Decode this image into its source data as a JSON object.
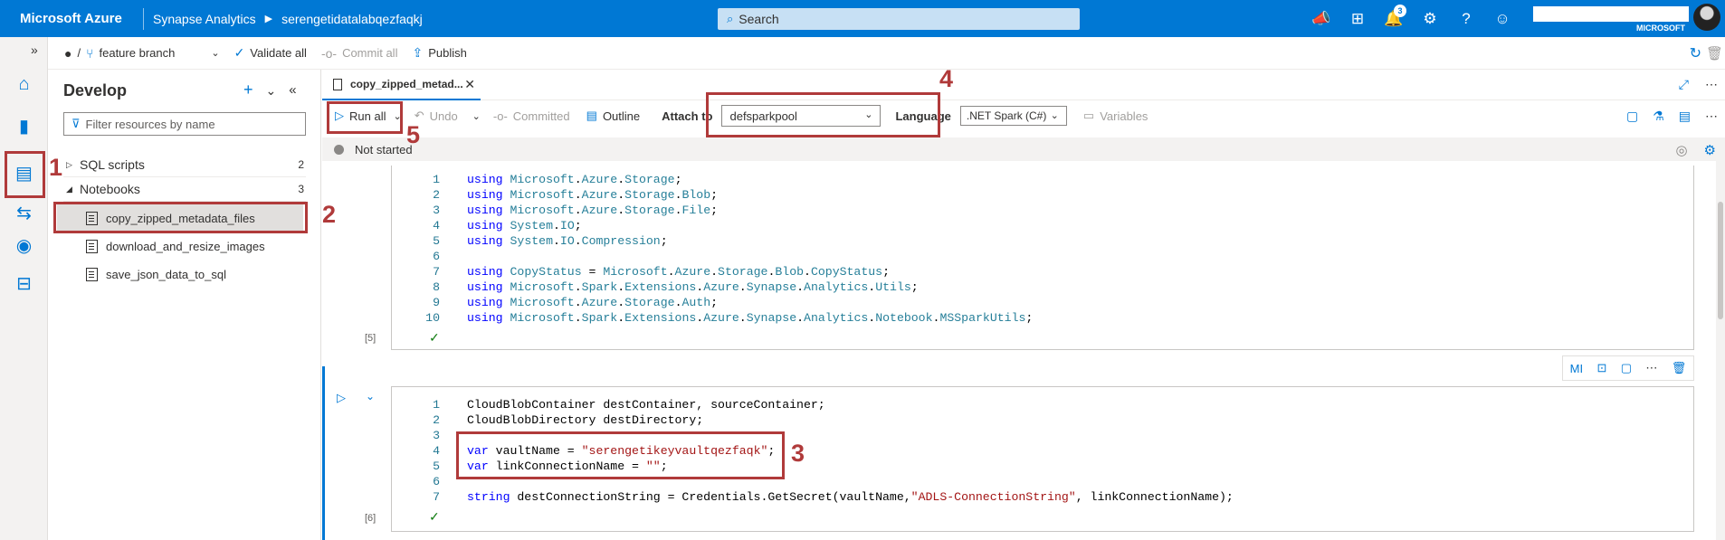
{
  "topbar": {
    "brand": "Microsoft Azure",
    "service": "Synapse Analytics",
    "workspace": "serengetidatalabqezfaqkj",
    "search_placeholder": "Search",
    "notifications_count": "3",
    "account_org": "MICROSOFT",
    "icons": [
      "announcement-icon",
      "portal-icon",
      "bell-icon",
      "gear-icon",
      "help-icon",
      "feedback-icon"
    ]
  },
  "git_toolbar": {
    "branch": "feature branch",
    "validate_all": "Validate all",
    "commit_all": "Commit all",
    "publish": "Publish",
    "separator": "/"
  },
  "develop": {
    "title": "Develop",
    "filter_placeholder": "Filter resources by name",
    "sections": [
      {
        "label": "SQL scripts",
        "count": "2"
      },
      {
        "label": "Notebooks",
        "count": "3"
      }
    ],
    "notebooks": [
      "copy_zipped_metadata_files",
      "download_and_resize_images",
      "save_json_data_to_sql"
    ]
  },
  "editor": {
    "tab_label": "copy_zipped_metad...",
    "toolbar": {
      "run_all": "Run all",
      "undo": "Undo",
      "committed": "Committed",
      "outline": "Outline",
      "attach_to_label": "Attach to",
      "attach_to_value": "defsparkpool",
      "language_label": "Language",
      "language_value": ".NET Spark (C#)",
      "variables": "Variables"
    },
    "status": "Not started"
  },
  "cells": [
    {
      "exec_count": "[5]",
      "lines": [
        {
          "n": "1",
          "tokens": [
            [
              "kw",
              "using"
            ],
            [
              "txt",
              " "
            ],
            [
              "ns",
              "Microsoft"
            ],
            [
              "txt",
              "."
            ],
            [
              "ns",
              "Azure"
            ],
            [
              "txt",
              "."
            ],
            [
              "ns",
              "Storage"
            ],
            [
              "txt",
              ";"
            ]
          ]
        },
        {
          "n": "2",
          "tokens": [
            [
              "kw",
              "using"
            ],
            [
              "txt",
              " "
            ],
            [
              "ns",
              "Microsoft"
            ],
            [
              "txt",
              "."
            ],
            [
              "ns",
              "Azure"
            ],
            [
              "txt",
              "."
            ],
            [
              "ns",
              "Storage"
            ],
            [
              "txt",
              "."
            ],
            [
              "ns",
              "Blob"
            ],
            [
              "txt",
              ";"
            ]
          ]
        },
        {
          "n": "3",
          "tokens": [
            [
              "kw",
              "using"
            ],
            [
              "txt",
              " "
            ],
            [
              "ns",
              "Microsoft"
            ],
            [
              "txt",
              "."
            ],
            [
              "ns",
              "Azure"
            ],
            [
              "txt",
              "."
            ],
            [
              "ns",
              "Storage"
            ],
            [
              "txt",
              "."
            ],
            [
              "ns",
              "File"
            ],
            [
              "txt",
              ";"
            ]
          ]
        },
        {
          "n": "4",
          "tokens": [
            [
              "kw",
              "using"
            ],
            [
              "txt",
              " "
            ],
            [
              "ns",
              "System"
            ],
            [
              "txt",
              "."
            ],
            [
              "ns",
              "IO"
            ],
            [
              "txt",
              ";"
            ]
          ]
        },
        {
          "n": "5",
          "tokens": [
            [
              "kw",
              "using"
            ],
            [
              "txt",
              " "
            ],
            [
              "ns",
              "System"
            ],
            [
              "txt",
              "."
            ],
            [
              "ns",
              "IO"
            ],
            [
              "txt",
              "."
            ],
            [
              "ns",
              "Compression"
            ],
            [
              "txt",
              ";"
            ]
          ]
        },
        {
          "n": "6",
          "tokens": []
        },
        {
          "n": "7",
          "tokens": [
            [
              "kw",
              "using"
            ],
            [
              "txt",
              " "
            ],
            [
              "ns",
              "CopyStatus"
            ],
            [
              "txt",
              " = "
            ],
            [
              "ns",
              "Microsoft"
            ],
            [
              "txt",
              "."
            ],
            [
              "ns",
              "Azure"
            ],
            [
              "txt",
              "."
            ],
            [
              "ns",
              "Storage"
            ],
            [
              "txt",
              "."
            ],
            [
              "ns",
              "Blob"
            ],
            [
              "txt",
              "."
            ],
            [
              "ns",
              "CopyStatus"
            ],
            [
              "txt",
              ";"
            ]
          ]
        },
        {
          "n": "8",
          "tokens": [
            [
              "kw",
              "using"
            ],
            [
              "txt",
              " "
            ],
            [
              "ns",
              "Microsoft"
            ],
            [
              "txt",
              "."
            ],
            [
              "ns",
              "Spark"
            ],
            [
              "txt",
              "."
            ],
            [
              "ns",
              "Extensions"
            ],
            [
              "txt",
              "."
            ],
            [
              "ns",
              "Azure"
            ],
            [
              "txt",
              "."
            ],
            [
              "ns",
              "Synapse"
            ],
            [
              "txt",
              "."
            ],
            [
              "ns",
              "Analytics"
            ],
            [
              "txt",
              "."
            ],
            [
              "ns",
              "Utils"
            ],
            [
              "txt",
              ";"
            ]
          ]
        },
        {
          "n": "9",
          "tokens": [
            [
              "kw",
              "using"
            ],
            [
              "txt",
              " "
            ],
            [
              "ns",
              "Microsoft"
            ],
            [
              "txt",
              "."
            ],
            [
              "ns",
              "Azure"
            ],
            [
              "txt",
              "."
            ],
            [
              "ns",
              "Storage"
            ],
            [
              "txt",
              "."
            ],
            [
              "ns",
              "Auth"
            ],
            [
              "txt",
              ";"
            ]
          ]
        },
        {
          "n": "10",
          "tokens": [
            [
              "kw",
              "using"
            ],
            [
              "txt",
              " "
            ],
            [
              "ns",
              "Microsoft"
            ],
            [
              "txt",
              "."
            ],
            [
              "ns",
              "Spark"
            ],
            [
              "txt",
              "."
            ],
            [
              "ns",
              "Extensions"
            ],
            [
              "txt",
              "."
            ],
            [
              "ns",
              "Azure"
            ],
            [
              "txt",
              "."
            ],
            [
              "ns",
              "Synapse"
            ],
            [
              "txt",
              "."
            ],
            [
              "ns",
              "Analytics"
            ],
            [
              "txt",
              "."
            ],
            [
              "ns",
              "Notebook"
            ],
            [
              "txt",
              "."
            ],
            [
              "ns",
              "MSSparkUtils"
            ],
            [
              "txt",
              ";"
            ]
          ]
        }
      ]
    },
    {
      "exec_count": "[6]",
      "lines": [
        {
          "n": "1",
          "tokens": [
            [
              "txt",
              "CloudBlobContainer destContainer, sourceContainer;"
            ]
          ]
        },
        {
          "n": "2",
          "tokens": [
            [
              "txt",
              "CloudBlobDirectory destDirectory;"
            ]
          ]
        },
        {
          "n": "3",
          "tokens": []
        },
        {
          "n": "4",
          "tokens": [
            [
              "kw",
              "var"
            ],
            [
              "txt",
              " vaultName = "
            ],
            [
              "str",
              "\"serengetikeyvaultqezfaqk\""
            ],
            [
              "txt",
              ";"
            ]
          ]
        },
        {
          "n": "5",
          "tokens": [
            [
              "kw",
              "var"
            ],
            [
              "txt",
              " linkConnectionName = "
            ],
            [
              "str",
              "\"\""
            ],
            [
              "txt",
              ";"
            ]
          ]
        },
        {
          "n": "6",
          "tokens": []
        },
        {
          "n": "7",
          "tokens": [
            [
              "kw",
              "string"
            ],
            [
              "txt",
              " destConnectionString = Credentials.GetSecret(vaultName,"
            ],
            [
              "str",
              "\"ADLS-ConnectionString\""
            ],
            [
              "txt",
              ", linkConnectionName);"
            ]
          ]
        }
      ]
    }
  ],
  "cell_tools": [
    "MI",
    "convert-icon",
    "comment-icon",
    "more-icon",
    "delete-icon"
  ],
  "annotations": [
    "1",
    "2",
    "3",
    "4",
    "5"
  ]
}
